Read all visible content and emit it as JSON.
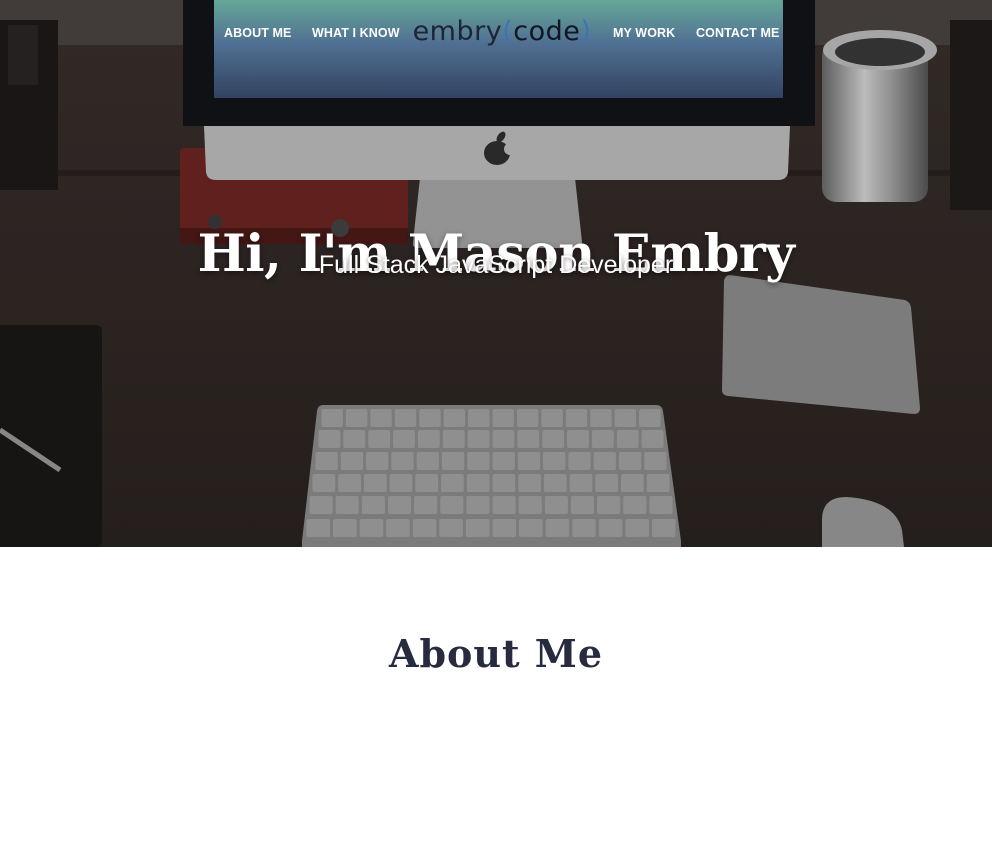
{
  "nav": {
    "items": [
      {
        "label": "ABOUT ME"
      },
      {
        "label": "WHAT I KNOW"
      },
      {
        "label": "MY WORK"
      },
      {
        "label": "CONTACT ME"
      }
    ],
    "logo": {
      "prefix": "embry",
      "open": "(",
      "word": "code",
      "close": ")"
    }
  },
  "hero": {
    "title": "Hi, I'm Mason Embry",
    "subtitle": "Full Stack JavaScript Developer"
  },
  "about": {
    "heading": "About Me"
  },
  "colors": {
    "heading_navy": "#262b3f",
    "logo_paren_blue": "#3f73b8",
    "hero_overlay": "#2b2624"
  }
}
